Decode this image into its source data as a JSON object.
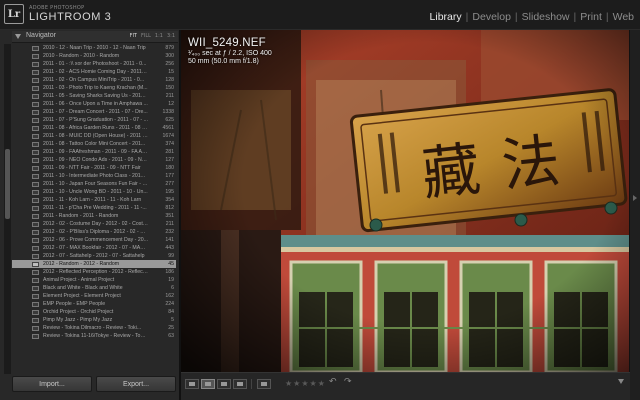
{
  "app": {
    "logo": "Lr",
    "brand_sub": "ADOBE PHOTOSHOP",
    "brand": "LIGHTROOM 3",
    "modules": [
      "Library",
      "Develop",
      "Slideshow",
      "Print",
      "Web"
    ],
    "active_module": "Library"
  },
  "navigator": {
    "title": "Navigator",
    "zooms": [
      "FIT",
      "FILL",
      "1:1",
      "3:1"
    ]
  },
  "collections": [
    {
      "name": "2010 - 12 - Naan Trip - 2010 - 12 - Naan Trip",
      "count": "879"
    },
    {
      "name": "2010 - Random - 2010 - Random",
      "count": "300"
    },
    {
      "name": "2011 - 01 - :\\\\ xor der Photoshoot - 2011 - 0...",
      "count": "256"
    },
    {
      "name": "2011 - 02 - ACS Homie Coming Day - 2011 - ...",
      "count": "15"
    },
    {
      "name": "2011 - 02 - On Campus MiniTrip - 2011 - 0...",
      "count": "128"
    },
    {
      "name": "2011 - 03 - Photo Trip to Kaeng Krachan (M...",
      "count": "150"
    },
    {
      "name": "2011 - 05 - Saving Sharks Saving Us - 2011 -...",
      "count": "211"
    },
    {
      "name": "2011 - 06 - Once Upon a Time in Amphawa ...",
      "count": "12"
    },
    {
      "name": "2011 - 07 - Dream Concert - 2011 - 07 - Dre...",
      "count": "1338"
    },
    {
      "name": "2011 - 07 - P'Sung Graduation - 2011 - 07 - ...",
      "count": "625"
    },
    {
      "name": "2011 - 08 - Africa Garden Runs - 2011 - 08 - ...",
      "count": "4561"
    },
    {
      "name": "2011 - 08 - MUIC DD (Open House) - 2011 - ...",
      "count": "1674"
    },
    {
      "name": "2011 - 08 - Tattoo Color Mini Concert - 201...",
      "count": "374"
    },
    {
      "name": "2011 - 09 - FAAfreshman - 2011 - 09 - FA Afr...",
      "count": "281"
    },
    {
      "name": "2011 - 09 - NEO Condo Ads - 2011 - 09 - NE...",
      "count": "127"
    },
    {
      "name": "2011 - 09 - NTT Fair - 2011 - 09 - NTT Fair",
      "count": "180"
    },
    {
      "name": "2011 - 10 - Intermediate Photo Class - 2011 ...",
      "count": "177"
    },
    {
      "name": "2011 - 10 - Japan Four Seasons Fun Fair - 2...",
      "count": "277"
    },
    {
      "name": "2011 - 10 - Uncle Wong BD - 2011 - 10 - Un...",
      "count": "195"
    },
    {
      "name": "2011 - 11 - Koh Larn - 2011 - 11 - Koh Larn",
      "count": "354"
    },
    {
      "name": "2011 - 11 - p'Cha Pre Wedding - 2011 - 11 -...",
      "count": "812"
    },
    {
      "name": "2011 - Random - 2011 - Random",
      "count": "351"
    },
    {
      "name": "2012 - 02 - Costume Day - 2012 - 02 - Costu...",
      "count": "211"
    },
    {
      "name": "2012 - 02 - P'Bliss's Diploma - 2012 - 02 - P'...",
      "count": "232"
    },
    {
      "name": "2012 - 06 - Prove Commencement Day - 20...",
      "count": "141"
    },
    {
      "name": "2012 - 07 - MAX Bookfair - 2012 - 07 - MAX ...",
      "count": "443"
    },
    {
      "name": "2012 - 07 - Sattahelp - 2012 - 07 - Sattahelp",
      "count": "99"
    },
    {
      "name": "2012 - Random - 2012 - Random",
      "count": "45",
      "selected": true
    },
    {
      "name": "2012 - Reflected Perception - 2012 - Reflect...",
      "count": "186"
    },
    {
      "name": "Animal Project - Animal Project",
      "count": "19"
    },
    {
      "name": "Black and White - Black and White",
      "count": "6"
    },
    {
      "name": "Element Project - Element Project",
      "count": "162"
    },
    {
      "name": "EMP People - EMP People",
      "count": "224"
    },
    {
      "name": "Orchid Project - Orchid Project",
      "count": "84"
    },
    {
      "name": "Pimp My Jazz - Pimp My Jazz",
      "count": "5"
    },
    {
      "name": "Review - Tokina Dilmacro - Review - Toki...",
      "count": "25"
    },
    {
      "name": "Review - Tokina 11-16/Tokye - Review - Tokin...",
      "count": "63"
    }
  ],
  "panel_buttons": {
    "import": "Import...",
    "export": "Export..."
  },
  "photo": {
    "filename": "WII_5249.NEF",
    "exposure": "¹⁄₄₀₀ sec at ƒ / 2.2, ISO 400",
    "lens": "50 mm (50.0 mm f/1.8)",
    "sign_chars": [
      "藏",
      "法"
    ],
    "colors": {
      "wall_red": "#b2432b",
      "sign_gold": "#b8862b",
      "sign_dark": "#3a200d",
      "trim_green": "#6f9a5e",
      "trim_teal": "#5e8e8a"
    }
  },
  "toolbar": {
    "stars": "★★★★★",
    "rotate_left": "↶",
    "rotate_right": "↷"
  }
}
